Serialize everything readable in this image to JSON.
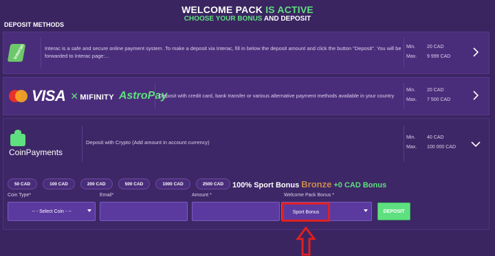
{
  "header": {
    "line1_a": "WELCOME PACK ",
    "line1_b": "IS ACTIVE",
    "line2_a": "CHOOSE ",
    "line2_b": "YOUR BONUS",
    "line2_c": " AND DEPOSIT"
  },
  "section_label": "DEPOSIT METHODS",
  "methods": [
    {
      "logo": "interac",
      "logo_text": "Interac",
      "description": "Interac is a safe and secure online payment system .To make a deposit via Interac, fill in below the deposit amount and click the button \"Deposit\". You will be forwarded to Interac page:...",
      "min_label": "Min.",
      "min_value": "20 CAD",
      "max_label": "Max.",
      "max_value": "9 999 CAD",
      "chevron": "chevron-right-icon"
    },
    {
      "logo": "visa-mifinity-astropay",
      "logo_visa": "VISA",
      "logo_mifinity": "MIFINITY",
      "logo_astropay": "AstroPay",
      "description": "Deposit with credit card, bank transfer or various alternative payment methods available in your country",
      "min_label": "Min.",
      "min_value": "20 CAD",
      "max_label": "Max.",
      "max_value": "7 500 CAD",
      "chevron": "chevron-right-icon"
    },
    {
      "logo": "coinpayments",
      "logo_text": "CoinPayments",
      "description": "Deposit with Crypto (Add amount in account currency)",
      "min_label": "Min.",
      "min_value": "40 CAD",
      "max_label": "Max.",
      "max_value": "100 000 CAD",
      "chevron": "chevron-down-icon"
    }
  ],
  "amounts": [
    "50 CAD",
    "100 CAD",
    "200 CAD",
    "500 CAD",
    "1000 CAD",
    "2500 CAD"
  ],
  "bonus": {
    "part1": "100% Sport Bonus ",
    "part2": "Bronze",
    "part3": " +0 CAD Bonus"
  },
  "form": {
    "coin_type_label": "Coin Type*",
    "coin_type_value": "-- - Select Coin - --",
    "email_label": "Email*",
    "email_value": "",
    "amount_label": "Amount *",
    "amount_value": "",
    "bonus_label": "Welcome Pack Bonus *",
    "bonus_value": "Sport Bonus",
    "deposit_label": "DEPOSIT"
  },
  "colors": {
    "background": "#3a2560",
    "card": "#4a2d7a",
    "accent_green": "#5fe080",
    "highlight_red": "#e02020",
    "bronze": "#c98a4a"
  }
}
